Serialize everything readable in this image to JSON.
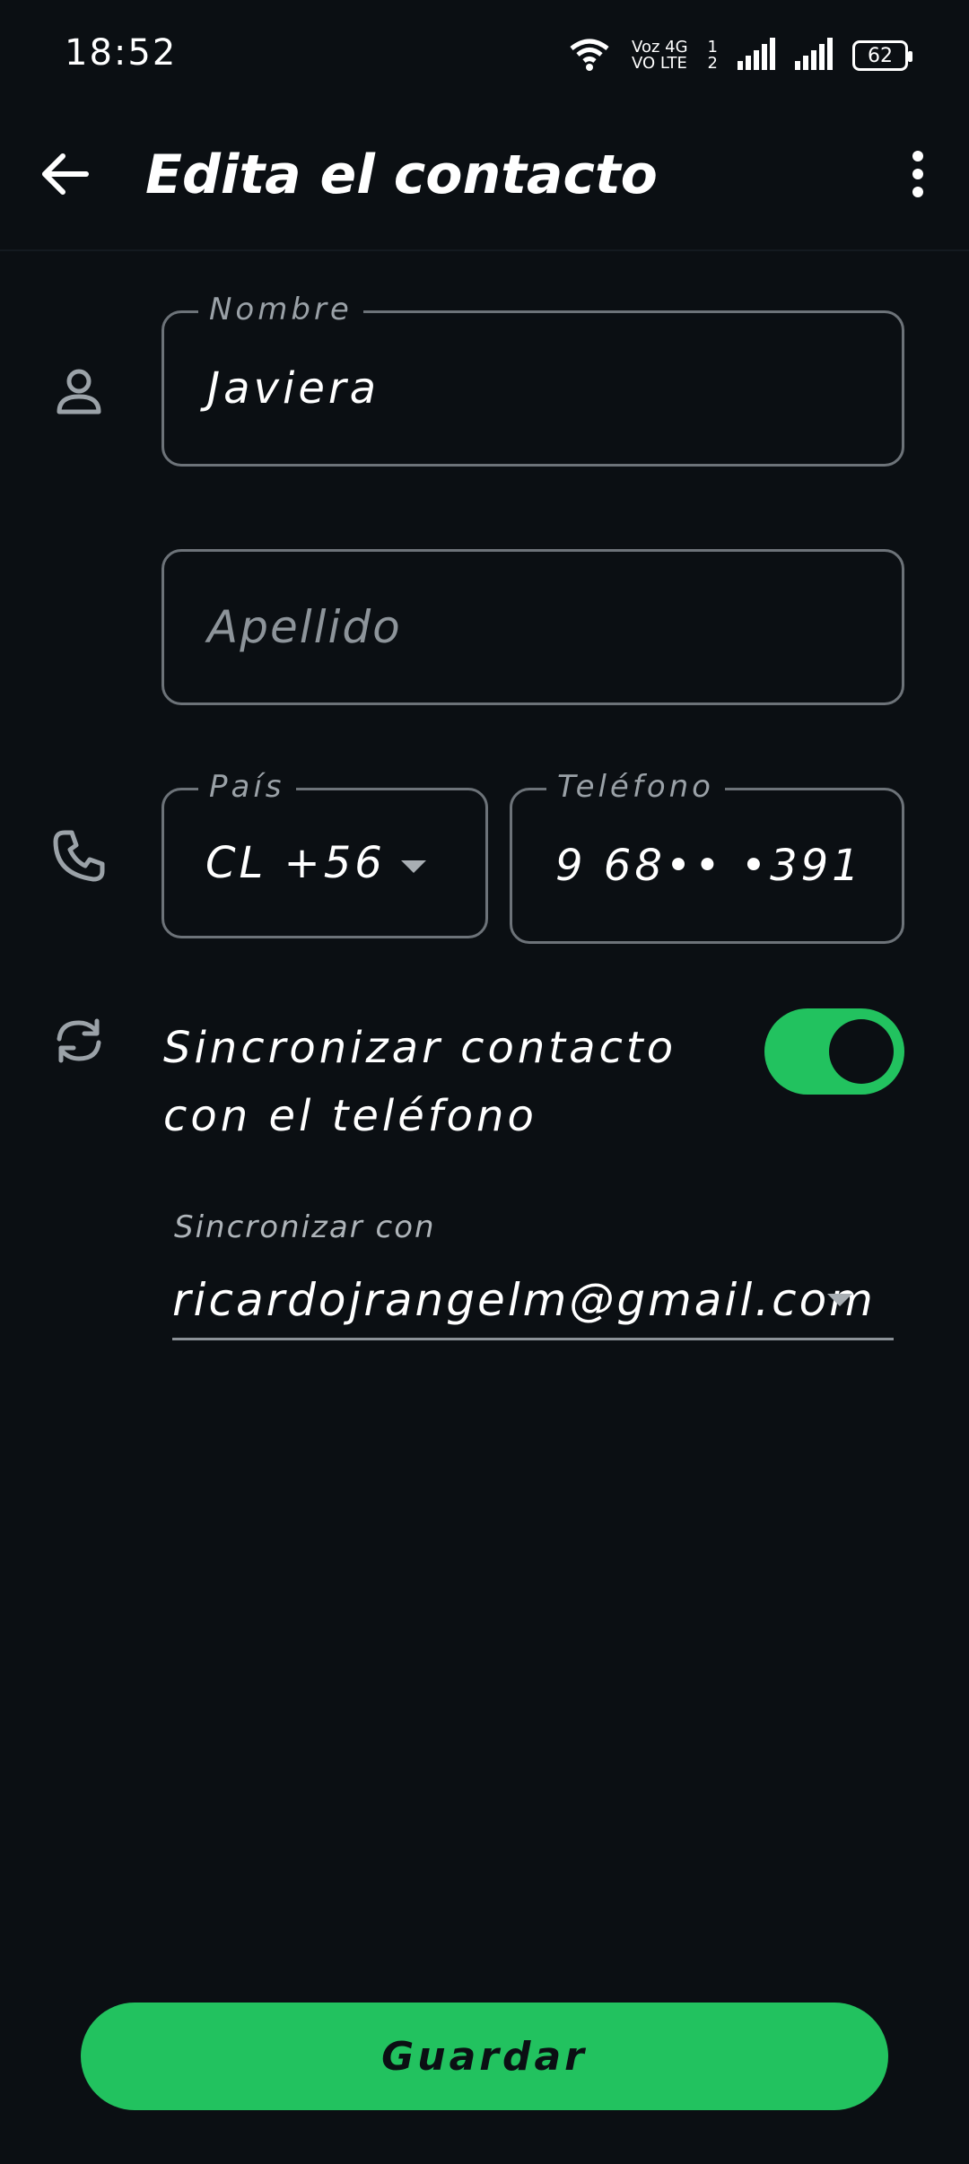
{
  "status_bar": {
    "time": "18:52",
    "network_label_top": "Voz 4G",
    "sim1": "1",
    "volte_label": "VO LTE",
    "sim2": "2",
    "battery": "62"
  },
  "app_bar": {
    "title": "Edita el contacto"
  },
  "form": {
    "first_name": {
      "label": "Nombre",
      "value": "Javiera"
    },
    "last_name": {
      "placeholder": "Apellido"
    },
    "country": {
      "label": "País",
      "value": "CL +56"
    },
    "phone": {
      "label": "Teléfono",
      "value": "9 68•• •391"
    },
    "sync": {
      "label": "Sincronizar contacto con el teléfono",
      "enabled": true
    },
    "sync_with": {
      "label": "Sincronizar con",
      "value": "ricardojrangelm@gmail.com"
    }
  },
  "actions": {
    "save_label": "Guardar"
  },
  "colors": {
    "background": "#0b0f13",
    "accent": "#22c25f",
    "outline": "#6d7379"
  }
}
